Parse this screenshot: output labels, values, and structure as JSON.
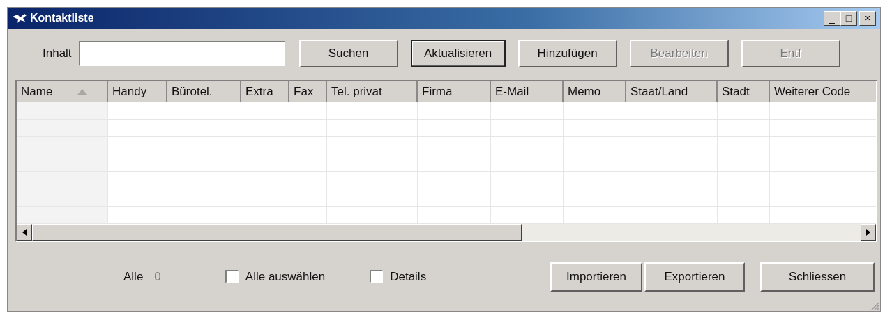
{
  "window": {
    "title": "Kontaktliste",
    "controls": [
      "_",
      "□",
      "×"
    ]
  },
  "search": {
    "label": "Inhalt"
  },
  "buttons": [
    {
      "label": "Suchen",
      "disabled": false,
      "default": false
    },
    {
      "label": "Aktualisieren",
      "disabled": false,
      "default": true
    },
    {
      "label": "Hinzufügen",
      "disabled": false,
      "default": false
    },
    {
      "label": "Bearbeiten",
      "disabled": true,
      "default": false
    },
    {
      "label": "Entf",
      "disabled": true,
      "default": false
    }
  ],
  "table": {
    "columns": [
      {
        "label": "Name",
        "sorted": true
      },
      {
        "label": "Handy",
        "sorted": false
      },
      {
        "label": "Bürotel.",
        "sorted": false
      },
      {
        "label": "Extra",
        "sorted": false
      },
      {
        "label": "Fax",
        "sorted": false
      },
      {
        "label": "Tel. privat",
        "sorted": false
      },
      {
        "label": "Firma",
        "sorted": false
      },
      {
        "label": "E-Mail",
        "sorted": false
      },
      {
        "label": "Memo",
        "sorted": false
      },
      {
        "label": "Staat/Land",
        "sorted": false
      },
      {
        "label": "Stadt",
        "sorted": false
      },
      {
        "label": "Weiterer Code",
        "sorted": false
      }
    ]
  },
  "footer": {
    "count_label": "Alle",
    "count": "0",
    "checkboxes": [
      {
        "label": "Alle auswählen",
        "checked": false
      },
      {
        "label": "Details",
        "checked": false
      }
    ],
    "buttons": [
      {
        "label": "Importieren"
      },
      {
        "label": "Exportieren"
      },
      {
        "label": "Schliessen"
      }
    ]
  }
}
